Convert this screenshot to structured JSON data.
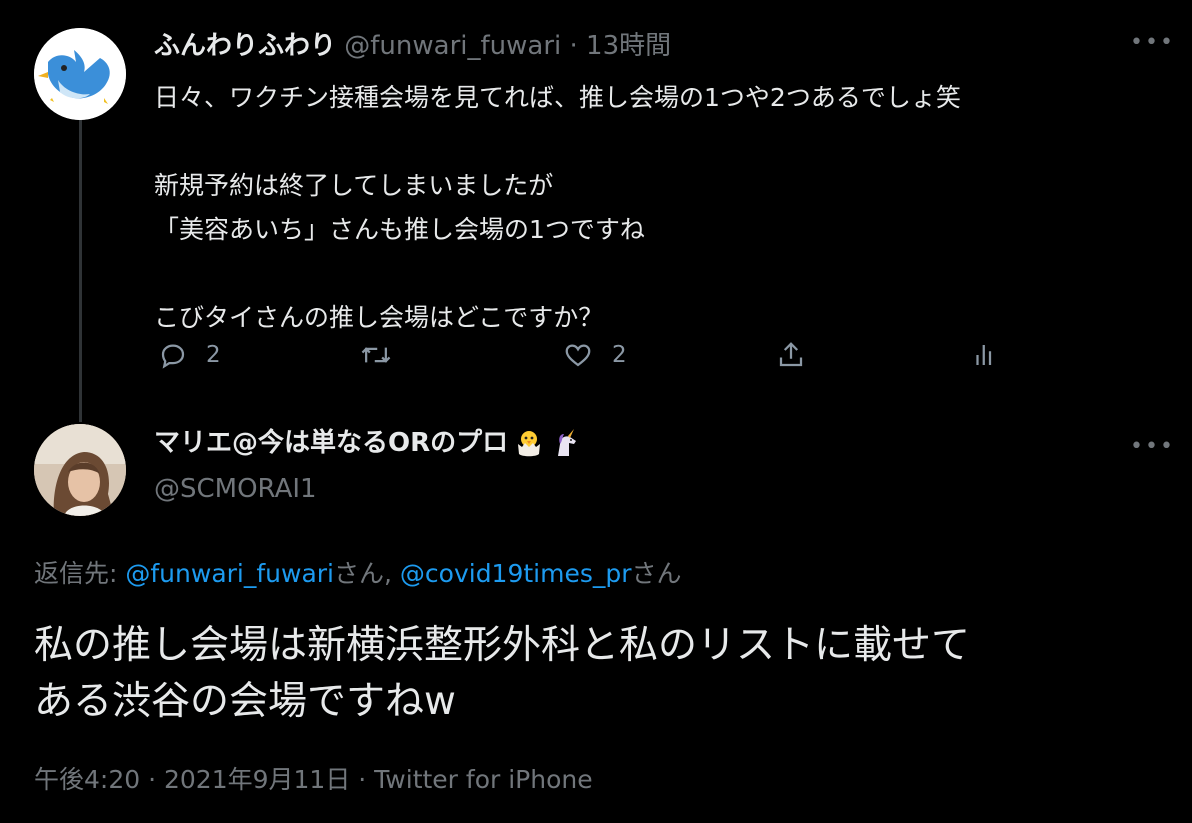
{
  "tweet1": {
    "display_name": "ふんわりふわり",
    "handle": "@funwari_fuwari",
    "separator": "·",
    "time": "13時間",
    "more_label": "•••",
    "body": "日々、ワクチン接種会場を見てれば、推し会場の1つや2つあるでしょ笑\n\n新規予約は終了してしまいましたが\n「美容あいち」さんも推し会場の1つですね\n\nこびタイさんの推し会場はどこですか？",
    "reply_count": "2",
    "retweet_count": "",
    "like_count": "2",
    "avatar_icon": "blue-bird-avatar"
  },
  "tweet2": {
    "display_name": "マリエ@今は単なるORのプロ",
    "handle": "@SCMORAI1",
    "more_label": "•••",
    "emojis": [
      "hatching-chick-emoji",
      "unicorn-emoji"
    ],
    "reply_prefix": "返信先: ",
    "mention1": "@funwari_fuwari",
    "mention1_suffix": "さん, ",
    "mention2": "@covid19times_pr",
    "mention2_suffix": "さん",
    "body": "私の推し会場は新横浜整形外科と私のリストに載せて\nある渋谷の会場ですねw",
    "time": "午後4:20",
    "dot1": " · ",
    "date": "2021年9月11日",
    "dot2": " · ",
    "source": "Twitter for iPhone"
  },
  "colors": {
    "background": "#000000",
    "text": "#e7e9ea",
    "muted": "#71767b",
    "link": "#1d9bf0"
  }
}
